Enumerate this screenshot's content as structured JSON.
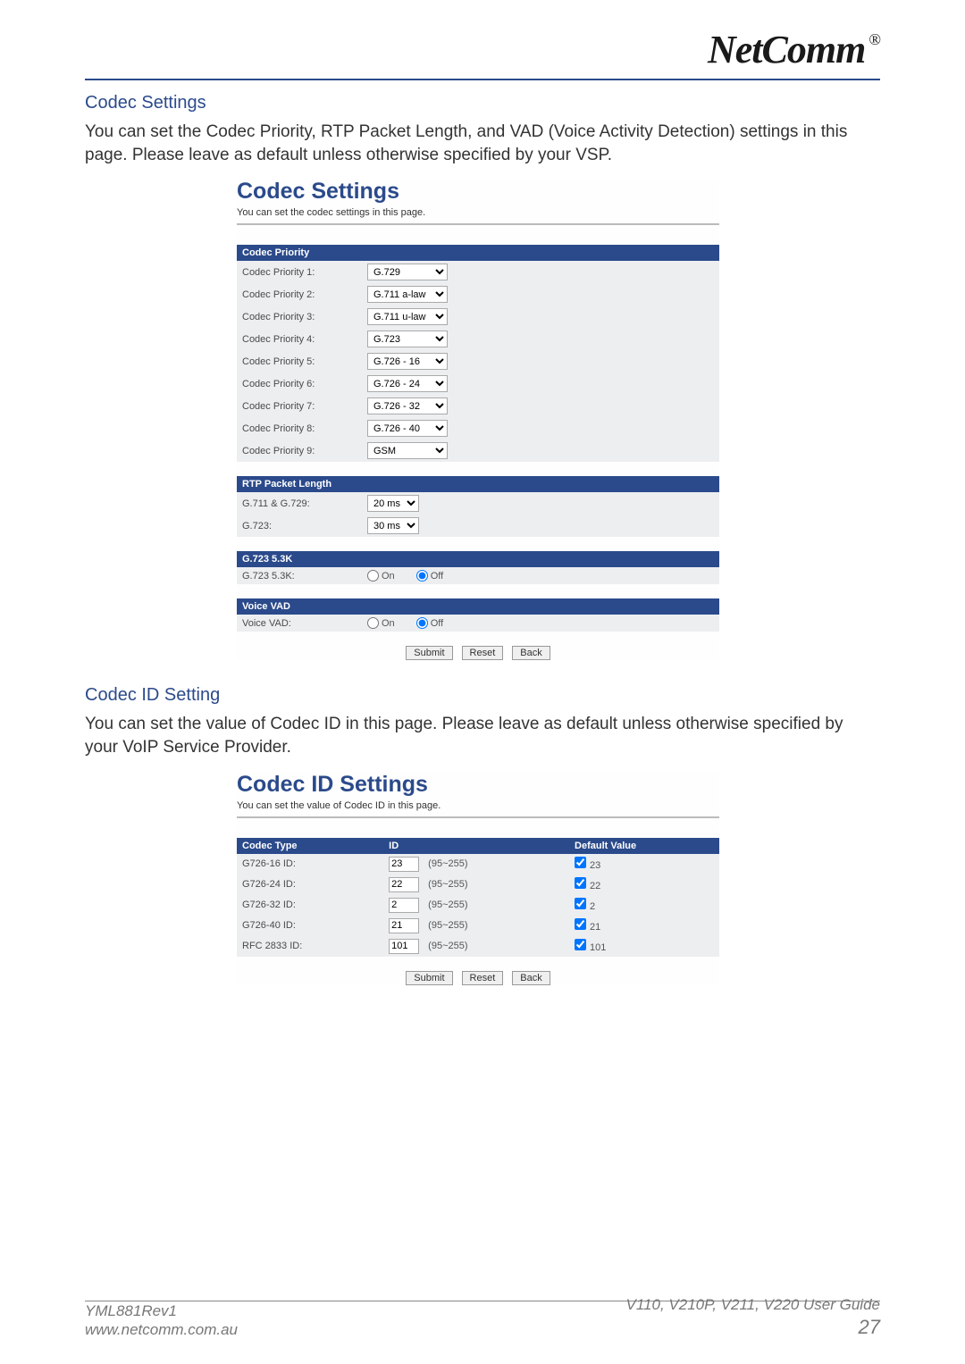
{
  "logo": {
    "text": "NetComm",
    "reg": "®"
  },
  "section1": {
    "title": "Codec Settings",
    "body": "You can set the Codec Priority, RTP Packet Length, and VAD (Voice Activity Detection) settings in this page. Please leave as default unless otherwise specified by your VSP."
  },
  "panel1": {
    "title": "Codec Settings",
    "sub": "You can set the codec settings in this page.",
    "codec_priority_header": "Codec Priority",
    "priorities": [
      {
        "label": "Codec Priority 1:",
        "value": "G.729"
      },
      {
        "label": "Codec Priority 2:",
        "value": "G.711 a-law"
      },
      {
        "label": "Codec Priority 3:",
        "value": "G.711 u-law"
      },
      {
        "label": "Codec Priority 4:",
        "value": "G.723"
      },
      {
        "label": "Codec Priority 5:",
        "value": "G.726 - 16"
      },
      {
        "label": "Codec Priority 6:",
        "value": "G.726 - 24"
      },
      {
        "label": "Codec Priority 7:",
        "value": "G.726 - 32"
      },
      {
        "label": "Codec Priority 8:",
        "value": "G.726 - 40"
      },
      {
        "label": "Codec Priority 9:",
        "value": "GSM"
      }
    ],
    "rtp_header": "RTP Packet Length",
    "rtp": [
      {
        "label": "G.711 & G.729:",
        "value": "20 ms"
      },
      {
        "label": "G.723:",
        "value": "30 ms"
      }
    ],
    "g723_header": "G.723 5.3K",
    "g723_label": "G.723 5.3K:",
    "vad_header": "Voice VAD",
    "vad_label": "Voice VAD:",
    "on_label": "On",
    "off_label": "Off",
    "buttons": {
      "submit": "Submit",
      "reset": "Reset",
      "back": "Back"
    }
  },
  "section2": {
    "title": "Codec ID Setting",
    "body": "You can set the value of Codec ID in this page. Please leave as default unless otherwise specified by your VoIP Service Provider."
  },
  "panel2": {
    "title": "Codec ID Settings",
    "sub": "You can set the value of Codec ID in this page.",
    "headers": {
      "type": "Codec Type",
      "id": "ID",
      "def": "Default Value"
    },
    "range_hint": "(95~255)",
    "rows": [
      {
        "label": "G726-16 ID:",
        "id": "23",
        "def": "23"
      },
      {
        "label": "G726-24 ID:",
        "id": "22",
        "def": "22"
      },
      {
        "label": "G726-32 ID:",
        "id": "2",
        "def": "2"
      },
      {
        "label": "G726-40 ID:",
        "id": "21",
        "def": "21"
      },
      {
        "label": "RFC 2833 ID:",
        "id": "101",
        "def": "101"
      }
    ],
    "buttons": {
      "submit": "Submit",
      "reset": "Reset",
      "back": "Back"
    }
  },
  "footer": {
    "left1": "YML881Rev1",
    "left2": "www.netcomm.com.au",
    "right1": "V110, V210P, V211, V220 User Guide",
    "right2": "27"
  }
}
